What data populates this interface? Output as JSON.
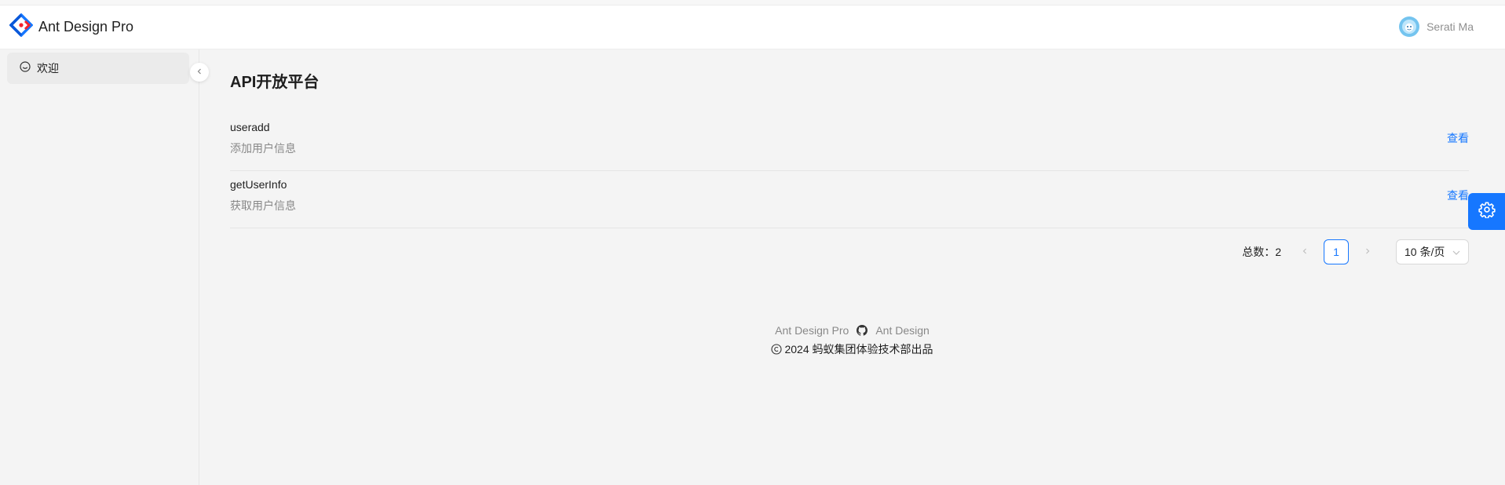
{
  "header": {
    "app_title": "Ant Design Pro",
    "username": "Serati Ma",
    "logo_icon": "ant-design-logo-icon",
    "avatar_icon": "avatar"
  },
  "sidebar": {
    "items": [
      {
        "label": "欢迎",
        "icon": "smile-icon"
      }
    ]
  },
  "main": {
    "title": "API开放平台",
    "list": [
      {
        "title": "useradd",
        "description": "添加用户信息",
        "action": "查看"
      },
      {
        "title": "getUserInfo",
        "description": "获取用户信息",
        "action": "查看"
      }
    ],
    "pagination": {
      "total_text": "总数：2",
      "current_page": "1",
      "page_size": "10 条/页"
    }
  },
  "footer": {
    "link1": "Ant Design Pro",
    "link2": "Ant Design",
    "copyright": "2024 蚂蚁集团体验技术部出品"
  },
  "colors": {
    "primary": "#1677ff"
  }
}
